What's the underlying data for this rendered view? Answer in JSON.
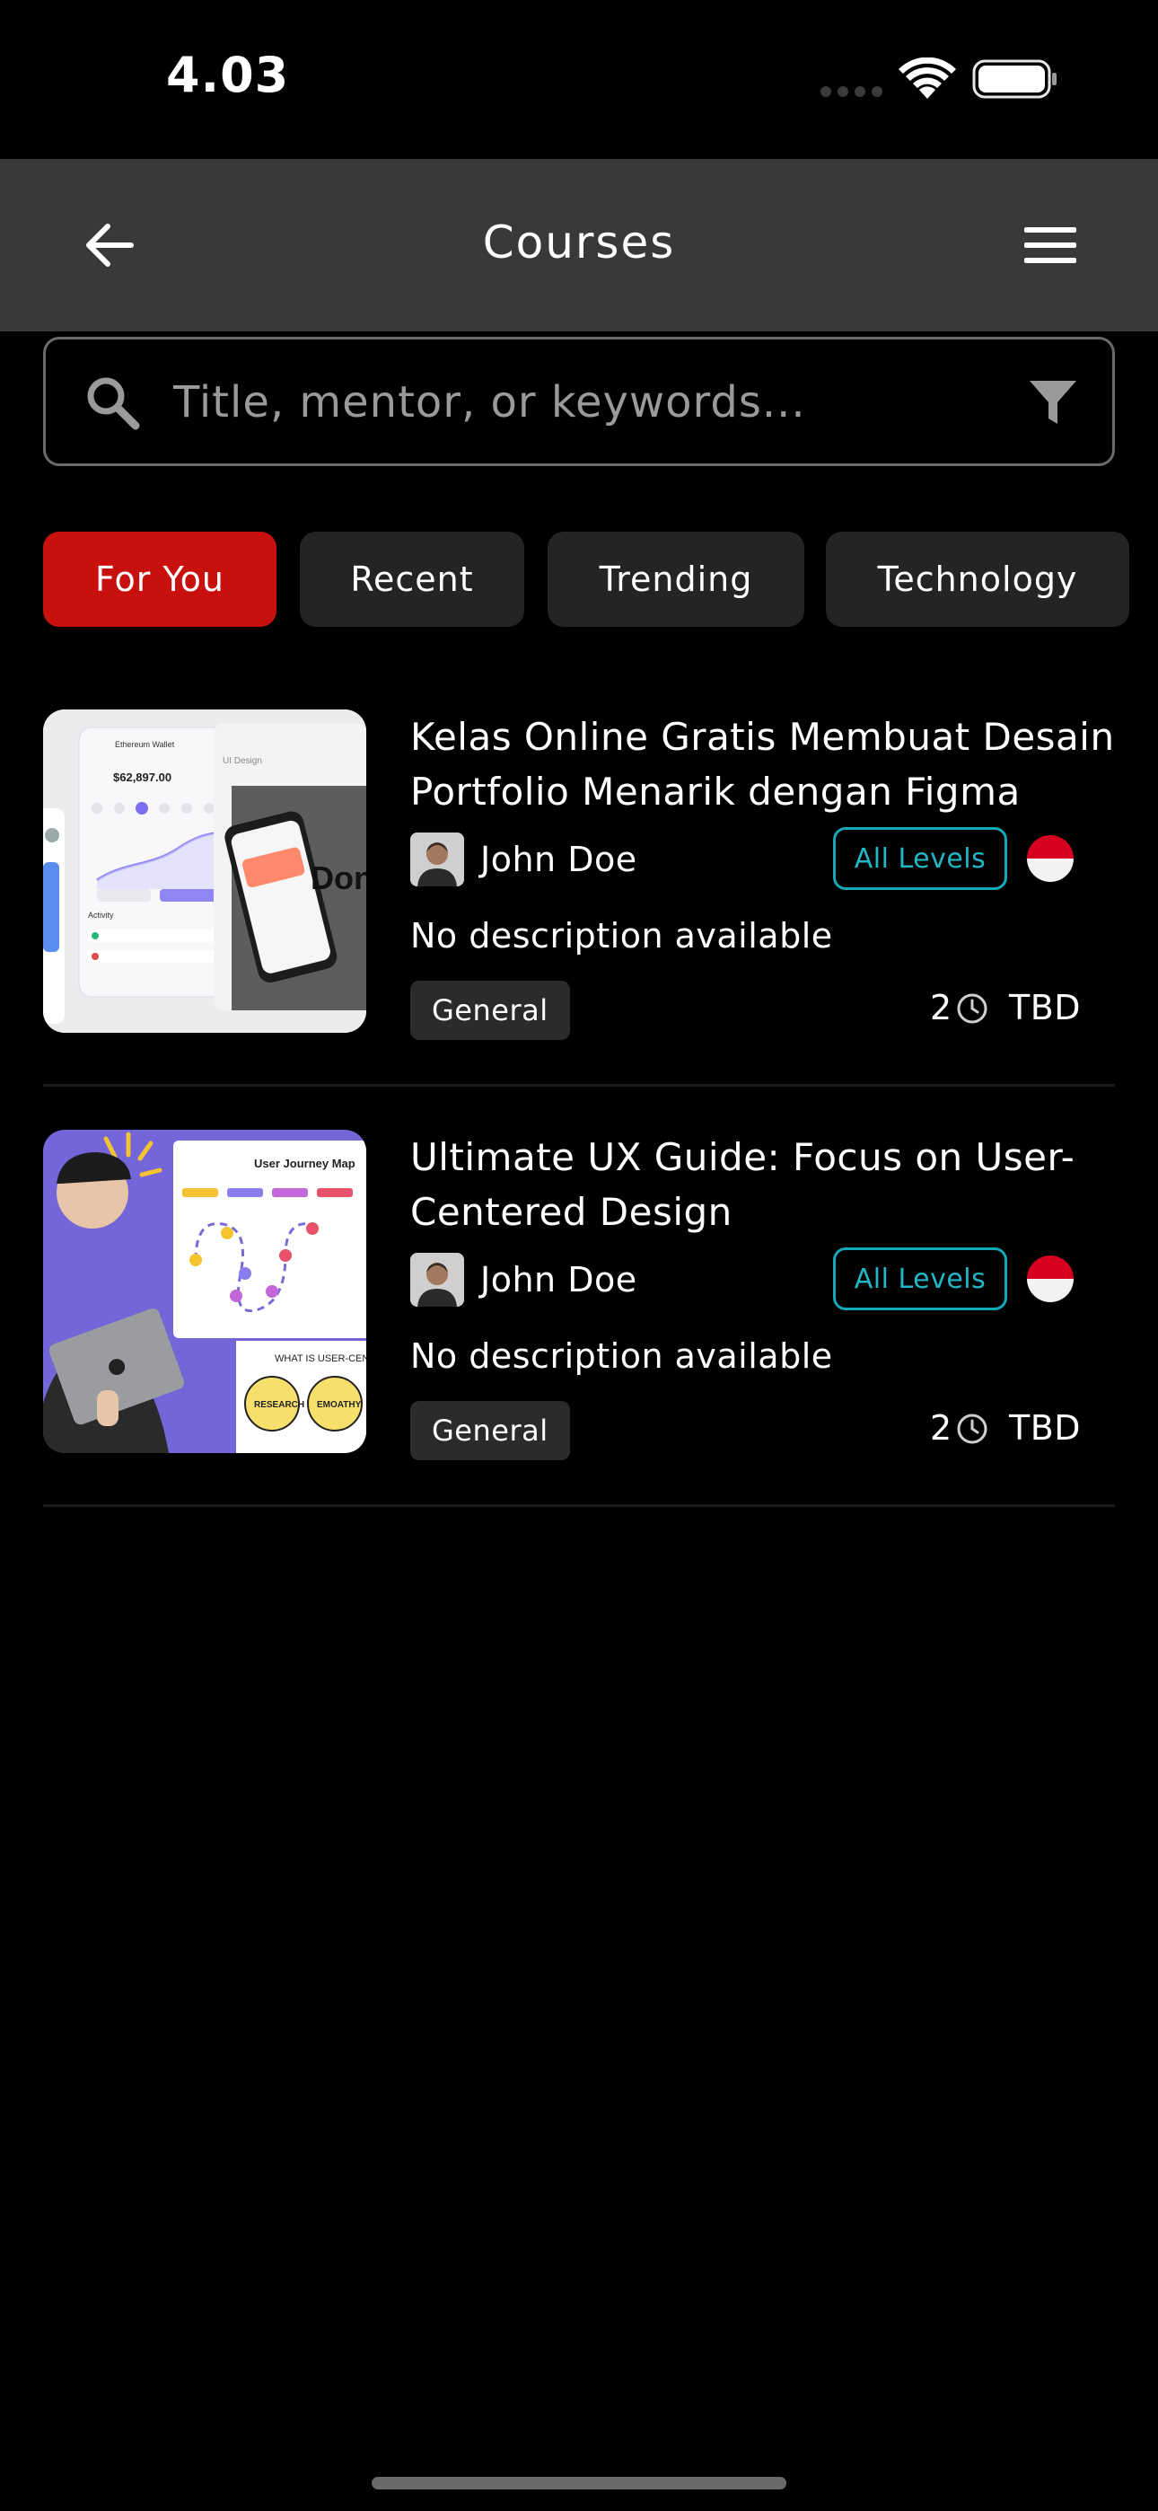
{
  "status_bar": {
    "time": "4.03"
  },
  "app_bar": {
    "title": "Courses",
    "back_icon": "arrow-left-icon",
    "menu_icon": "hamburger-menu-icon"
  },
  "search": {
    "placeholder": "Title, mentor, or keywords...",
    "value": "",
    "filter_icon": "filter-funnel-icon"
  },
  "tabs": [
    {
      "label": "For You",
      "active": true
    },
    {
      "label": "Recent",
      "active": false
    },
    {
      "label": "Trending",
      "active": false
    },
    {
      "label": "Technology",
      "active": false
    }
  ],
  "courses": [
    {
      "title": "Kelas Online Gratis Membuat Desain Portfolio Menarik dengan Figma",
      "mentor": "John Doe",
      "level": "All Levels",
      "description": "No description available",
      "category": "General",
      "count": "2",
      "duration": "TBD",
      "thumb_text": {
        "wallet": "Ethereum Wallet",
        "balance": "$62,897.00",
        "ui": "UI Design",
        "activity": "Activity",
        "big": "Don Cry"
      }
    },
    {
      "title": "Ultimate UX Guide: Focus on User-Centered Design",
      "mentor": "John Doe",
      "level": "All Levels",
      "description": "No description available",
      "category": "General",
      "count": "2",
      "duration": "TBD",
      "thumb_text": {
        "map": "User Journey Map",
        "what": "WHAT IS USER-CENTERED",
        "research": "RESEARCH",
        "empathy": "EMOATHY"
      }
    }
  ],
  "colors": {
    "accent": "#c8100f",
    "app_bar": "#393939",
    "level_badge": "#13a9b8",
    "background": "#000000"
  }
}
